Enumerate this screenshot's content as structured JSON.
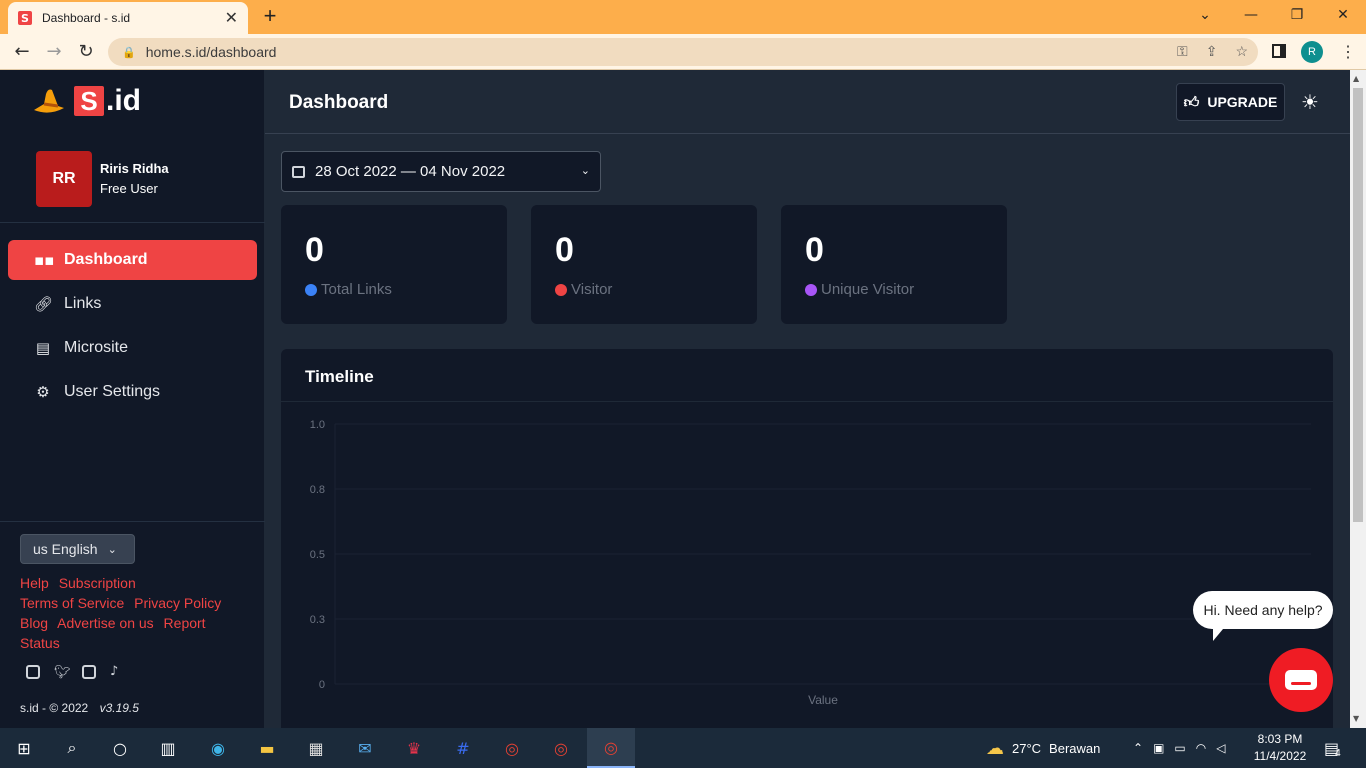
{
  "browser": {
    "tab_title": "Dashboard - s.id",
    "tab_favicon": "S",
    "url": "home.s.id/dashboard",
    "profile_initial": "R"
  },
  "brand": {
    "logo_letter": "S",
    "logo_text": ".id"
  },
  "user": {
    "initials": "RR",
    "name": "Riris Ridha",
    "plan": "Free User"
  },
  "sidebar": {
    "items": [
      {
        "label": "Dashboard",
        "icon": "grid-icon",
        "active": true
      },
      {
        "label": "Links",
        "icon": "link-icon",
        "active": false
      },
      {
        "label": "Microsite",
        "icon": "microsite-icon",
        "active": false
      },
      {
        "label": "User Settings",
        "icon": "gear-icon",
        "active": false
      }
    ],
    "language": "us English",
    "footer_links": {
      "help": "Help",
      "subscription": "Subscription",
      "terms": "Terms of Service",
      "privacy": "Privacy Policy",
      "blog": "Blog",
      "advertise": "Advertise on us",
      "report": "Report",
      "status": "Status"
    },
    "copyright": "s.id - © 2022",
    "version": "v3.19.5"
  },
  "header": {
    "title": "Dashboard",
    "upgrade_label": "UPGRADE"
  },
  "filters": {
    "date_range": "28 Oct 2022 — 04 Nov 2022"
  },
  "stats": [
    {
      "value": "0",
      "label": "Total Links",
      "color": "#3b82f6"
    },
    {
      "value": "0",
      "label": "Visitor",
      "color": "#ef4444"
    },
    {
      "value": "0",
      "label": "Unique Visitor",
      "color": "#a855f7"
    }
  ],
  "timeline": {
    "title": "Timeline"
  },
  "chart_data": {
    "type": "line",
    "title": "Timeline",
    "xlabel": "Value",
    "ylabel": "",
    "yticks": [
      "1.0",
      "0.8",
      "0.5",
      "0.3",
      "0"
    ],
    "ylim": [
      0,
      1
    ],
    "series": [],
    "grid": true
  },
  "chat": {
    "bubble_text": "Hi. Need any help?"
  },
  "taskbar": {
    "weather_temp": "27°C",
    "weather_text": "Berawan",
    "time": "8:03 PM",
    "date": "11/4/2022",
    "notification_count": "4"
  },
  "colors": {
    "accent": "#ef4444",
    "sidebar_bg": "#111827",
    "main_bg": "#1f2937",
    "browser_frame": "#fdae4b"
  }
}
